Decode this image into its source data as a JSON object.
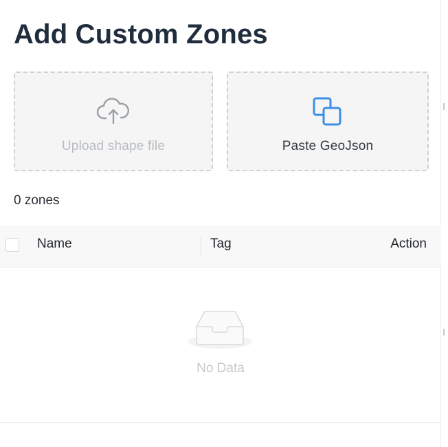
{
  "header": {
    "title": "Add Custom Zones"
  },
  "upload_card": {
    "label": "Upload shape file",
    "icon": "cloud-upload-icon"
  },
  "paste_card": {
    "label": "Paste GeoJson",
    "icon": "copy-squares-icon",
    "icon_color": "#3d8de6"
  },
  "zones": {
    "count_text": "0 zones"
  },
  "table": {
    "columns": [
      "Name",
      "Tag",
      "Action"
    ],
    "empty_text": "No Data",
    "empty_icon": "empty-inbox-icon"
  }
}
